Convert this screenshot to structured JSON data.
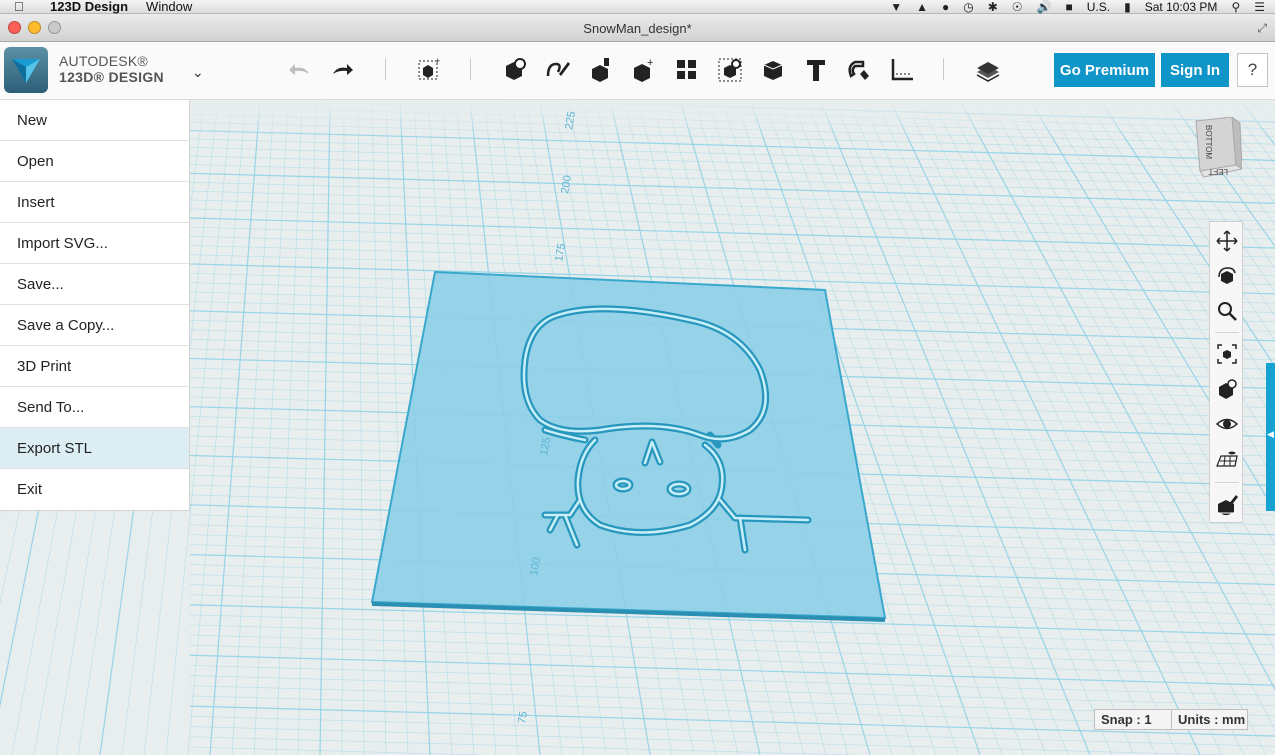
{
  "menubar": {
    "app_name": "123D Design",
    "menu_window": "Window",
    "input_source": "U.S.",
    "clock": "Sat 10:03 PM"
  },
  "window": {
    "title": "SnowMan_design*"
  },
  "brand": {
    "line1": "AUTODESK®",
    "line2": "123D® DESIGN"
  },
  "toolbar": {
    "icons": [
      "undo-icon",
      "redo-icon",
      "transform-icon",
      "primitives-icon",
      "sketch-icon",
      "construct-icon",
      "modify-icon",
      "pattern-icon",
      "group-icon",
      "combine-icon",
      "text-icon",
      "snap-icon",
      "measure-icon",
      "material-icon"
    ],
    "go_premium": "Go Premium",
    "sign_in": "Sign In",
    "help": "?"
  },
  "file_menu": {
    "items": [
      {
        "label": "New"
      },
      {
        "label": "Open"
      },
      {
        "label": "Insert"
      },
      {
        "label": "Import SVG..."
      },
      {
        "label": "Save..."
      },
      {
        "label": "Save a Copy..."
      },
      {
        "label": "3D Print"
      },
      {
        "label": "Send To..."
      },
      {
        "label": "Export STL"
      },
      {
        "label": "Exit"
      }
    ],
    "active_index": 8
  },
  "viewcube": {
    "face_top": "BOTTOM",
    "face_side": "LEFT"
  },
  "grid": {
    "labels": [
      "225",
      "200",
      "175",
      "125",
      "100",
      "75"
    ]
  },
  "navbar": {
    "icons": [
      "pan-icon",
      "orbit-icon",
      "zoom-icon",
      "fit-icon",
      "view-cube-icon",
      "visibility-icon",
      "grid-icon",
      "material-edit-icon"
    ]
  },
  "status": {
    "snap": "Snap : 1",
    "units": "Units : mm"
  },
  "colors": {
    "accent": "#0f95c7",
    "grid_line": "#8fd1e6",
    "plate_fill": "#8dcfe8"
  }
}
